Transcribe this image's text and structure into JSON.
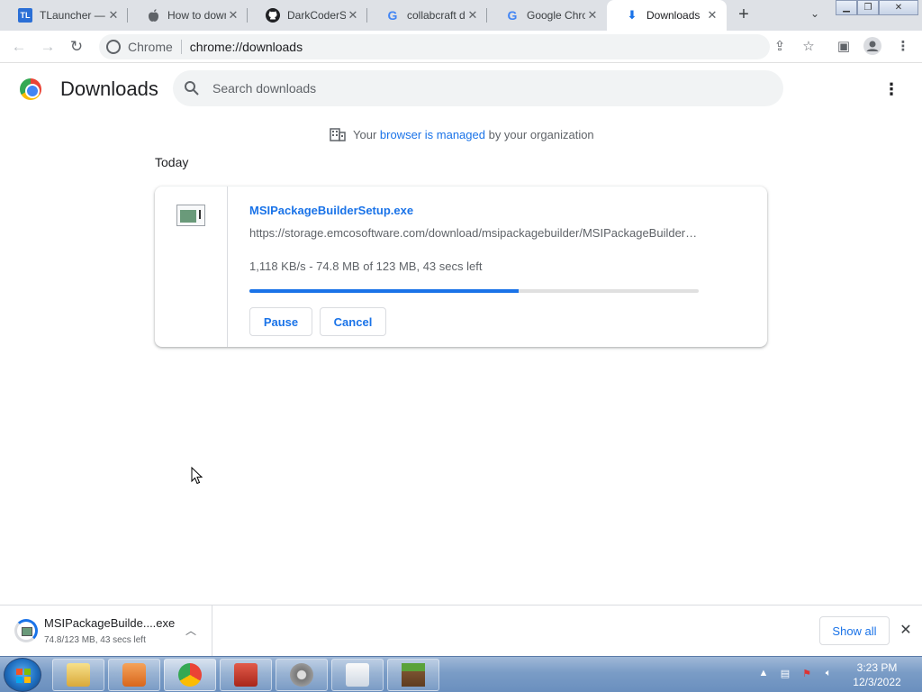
{
  "tabs": [
    {
      "title": "TLauncher — Minecraft",
      "icon": "tlauncher-icon",
      "favtext": "TL",
      "color": "#2b6fd6"
    },
    {
      "title": "How to download MSI Package Builder",
      "icon": "apple-icon",
      "favtext": "",
      "color": "#5f6368"
    },
    {
      "title": "DarkCoderSc",
      "icon": "github-icon",
      "favtext": "",
      "color": "#202124"
    },
    {
      "title": "collabcraft download",
      "icon": "google-icon",
      "favtext": "G",
      "color": "#4285f4"
    },
    {
      "title": "Google Chrome",
      "icon": "google-icon",
      "favtext": "G",
      "color": "#4285f4"
    },
    {
      "title": "Downloads",
      "icon": "download-icon",
      "favtext": "⬇",
      "color": "#1a73e8"
    }
  ],
  "toolbar": {
    "site_chip": "Chrome",
    "url": "chrome://downloads"
  },
  "page": {
    "title": "Downloads",
    "search_placeholder": "Search downloads",
    "managed_prefix": "Your",
    "managed_link": "browser is managed",
    "managed_suffix": "by your organization",
    "section": "Today"
  },
  "download": {
    "filename": "MSIPackageBuilderSetup.exe",
    "url": "https://storage.emcosoftware.com/download/msipackagebuilder/MSIPackageBuilderSetup.exe",
    "status": "1,118 KB/s - 74.8 MB of 123 MB, 43 secs left",
    "progress": 0.6,
    "pause_label": "Pause",
    "cancel_label": "Cancel"
  },
  "shelf": {
    "name": "MSIPackageBuilde....exe",
    "status": "74.8/123 MB, 43 secs left",
    "show_all": "Show all"
  },
  "taskbar": {
    "time": "3:23 PM",
    "date": "12/3/2022",
    "apps": [
      "file-explorer-icon",
      "media-player-icon",
      "chrome-icon",
      "toolbox-icon",
      "settings-gear-icon",
      "java-icon",
      "minecraft-icon"
    ]
  },
  "colors": {
    "accent": "#1a73e8",
    "progress_track": "#e0e0e0"
  }
}
